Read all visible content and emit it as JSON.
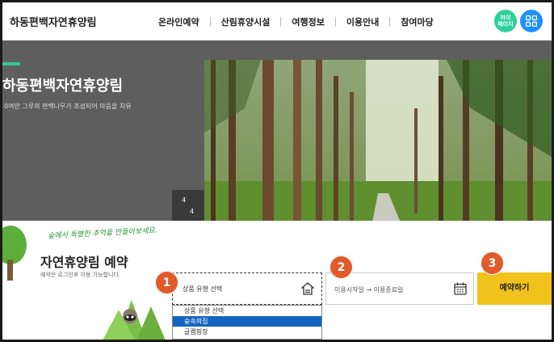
{
  "header": {
    "logo": "하동편백자연휴양림",
    "nav": [
      "온라인예약",
      "산림휴양시설",
      "여행정보",
      "이용안내",
      "참여마당"
    ],
    "mypage_line1": "마이",
    "mypage_line2": "페이지"
  },
  "hero": {
    "title": "하동편백자연휴양림",
    "subtitle": "0여만 그루의 편백나무가 조성되어 마음을 치유",
    "slide_current": "4",
    "slide_total": "4",
    "prev_symbol": "⇠",
    "next_symbol": "⇢"
  },
  "reservation": {
    "script_text": "숲에서 특별한 추억을 만들어보세요.",
    "title": "자연휴양림 예약",
    "note": "예약은 로그인후 이용 가능합니다.",
    "select_text": "상품 유형 선택",
    "date_text": "이용시작일 → 이용종료일",
    "book_button": "예약하기",
    "options": [
      "상품 유형 선택",
      "숲속의집",
      "글램핑장"
    ],
    "selected_option_index": 1
  },
  "badges": [
    "1",
    "2",
    "3"
  ],
  "colors": {
    "accent_green": "#33c69a",
    "mypage_green": "#2ecf9a",
    "menu_blue": "#1e90ff",
    "book_yellow": "#f2c21c",
    "badge_orange": "#e05a2a",
    "option_highlight": "#1565c0"
  },
  "icons": {
    "allmenu": "grid-icon",
    "select": "house-icon",
    "date": "calendar-icon"
  }
}
